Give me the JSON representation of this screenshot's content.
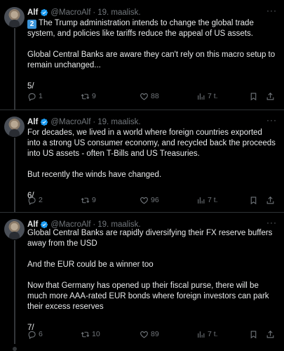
{
  "tweets": [
    {
      "author": {
        "name": "Alf",
        "handle": "@MacroAlf",
        "date": "19. maalisk."
      },
      "number_badge": "2",
      "paragraphs": [
        "The Trump administration intends to change the global trade system, and policies like tariffs reduce the appeal of US assets.",
        "Global Central Banks are aware they can't rely on this macro setup to remain unchanged...",
        "5/"
      ],
      "stats": {
        "replies": "1",
        "retweets": "9",
        "likes": "88",
        "views": "7 t."
      }
    },
    {
      "author": {
        "name": "Alf",
        "handle": "@MacroAlf",
        "date": "19. maalisk."
      },
      "paragraphs": [
        "For decades, we lived in a world where foreign countries exported into a strong US consumer economy, and recycled back the proceeds into US assets - often T-Bills and US Treasuries.",
        "But recently the winds have changed.",
        "6/"
      ],
      "stats": {
        "replies": "2",
        "retweets": "9",
        "likes": "96",
        "views": "7 t."
      }
    },
    {
      "author": {
        "name": "Alf",
        "handle": "@MacroAlf",
        "date": "19. maalisk."
      },
      "paragraphs": [
        "Global Central Banks are rapidly diversifying their FX reserve buffers away from the USD",
        "And the EUR could be a winner too",
        "Now that Germany has opened up their fiscal purse, there will be much more AAA-rated EUR bonds where foreign investors can park their excess reserves",
        "7/"
      ],
      "stats": {
        "replies": "6",
        "retweets": "10",
        "likes": "89",
        "views": "7 t."
      }
    }
  ],
  "colors": {
    "background": "#000000",
    "text": "#e7e9ea",
    "muted": "#71767b",
    "verified": "#1d9bf0",
    "divider": "#2f3336"
  },
  "icons": [
    "verified-badge-icon",
    "more-icon",
    "reply-icon",
    "retweet-icon",
    "like-icon",
    "views-icon",
    "bookmark-icon",
    "share-icon"
  ]
}
